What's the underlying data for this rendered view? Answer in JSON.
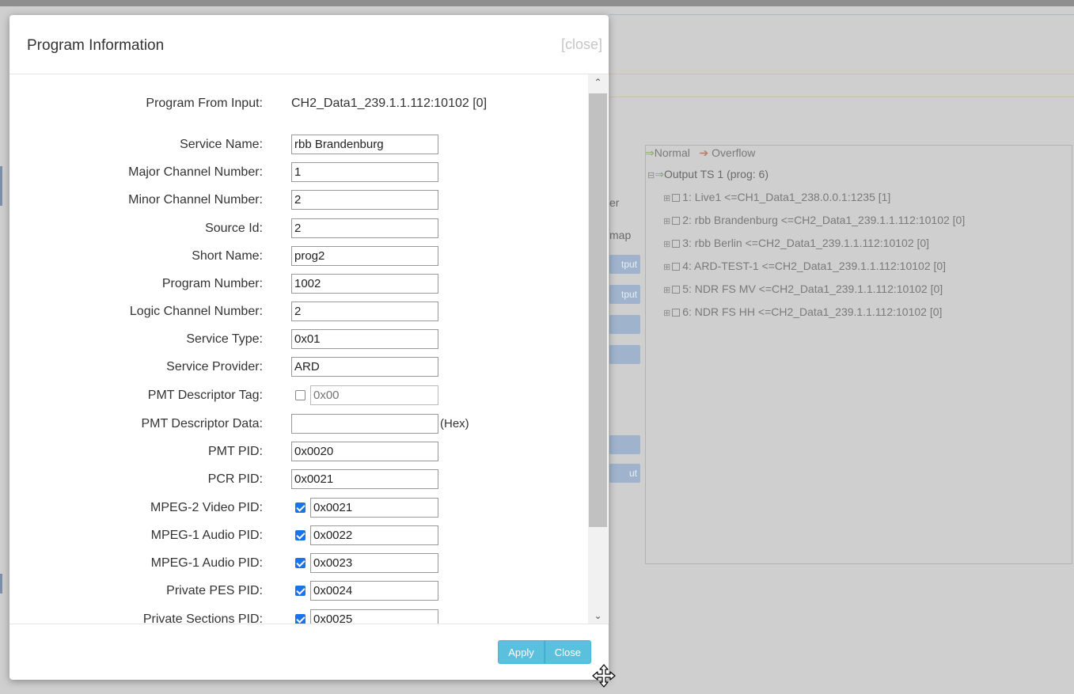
{
  "background": {
    "partial_labels": [
      "er",
      "map",
      "tput",
      "tput",
      "ut"
    ],
    "legend": {
      "normal_label": "Normal",
      "overflow_label": "Overflow"
    },
    "tree": {
      "root": "Output TS 1 (prog: 6)",
      "items": [
        "1: Live1 <=CH1_Data1_238.0.0.1:1235 [1]",
        "2: rbb Brandenburg <=CH2_Data1_239.1.1.112:10102 [0]",
        "3: rbb Berlin <=CH2_Data1_239.1.1.112:10102 [0]",
        "4: ARD-TEST-1 <=CH2_Data1_239.1.1.112:10102 [0]",
        "5: NDR FS MV <=CH2_Data1_239.1.1.112:10102 [0]",
        "6: NDR FS HH <=CH2_Data1_239.1.1.112:10102 [0]"
      ]
    }
  },
  "modal": {
    "title": "Program Information",
    "close_link": "[close]",
    "program_from_input": {
      "label": "Program From Input:",
      "value": "CH2_Data1_239.1.1.112:10102 [0]"
    },
    "fields": [
      {
        "label": "Service Name:",
        "value": "rbb Brandenburg"
      },
      {
        "label": "Major Channel Number:",
        "value": "1"
      },
      {
        "label": "Minor Channel Number:",
        "value": "2"
      },
      {
        "label": "Source Id:",
        "value": "2"
      },
      {
        "label": "Short Name:",
        "value": "prog2"
      },
      {
        "label": "Program Number:",
        "value": "1002"
      },
      {
        "label": "Logic Channel Number:",
        "value": "2"
      },
      {
        "label": "Service Type:",
        "value": "0x01"
      },
      {
        "label": "Service Provider:",
        "value": "ARD"
      }
    ],
    "pmt_descriptor_tag": {
      "label": "PMT Descriptor Tag:",
      "placeholder": "0x00",
      "checked": false
    },
    "pmt_descriptor_data": {
      "label": "PMT Descriptor Data:",
      "value": "",
      "suffix": "(Hex)"
    },
    "pmt_pid": {
      "label": "PMT PID:",
      "value": "0x0020"
    },
    "pcr_pid": {
      "label": "PCR PID:",
      "value": "0x0021"
    },
    "pid_rows": [
      {
        "label": "MPEG-2 Video PID:",
        "value": "0x0021",
        "checked": true
      },
      {
        "label": "MPEG-1 Audio PID:",
        "value": "0x0022",
        "checked": true
      },
      {
        "label": "MPEG-1 Audio PID:",
        "value": "0x0023",
        "checked": true
      },
      {
        "label": "Private PES PID:",
        "value": "0x0024",
        "checked": true
      },
      {
        "label": "Private Sections PID:",
        "value": "0x0025",
        "checked": true
      }
    ],
    "footer": {
      "apply_label": "Apply",
      "close_label": "Close"
    }
  },
  "colors": {
    "button": "#5bc0de",
    "checkbox": "#1a73e8"
  },
  "icons": {
    "resize": "move-cursor-icon",
    "scroll_up": "chevron-up-icon",
    "scroll_down": "chevron-down-icon"
  }
}
